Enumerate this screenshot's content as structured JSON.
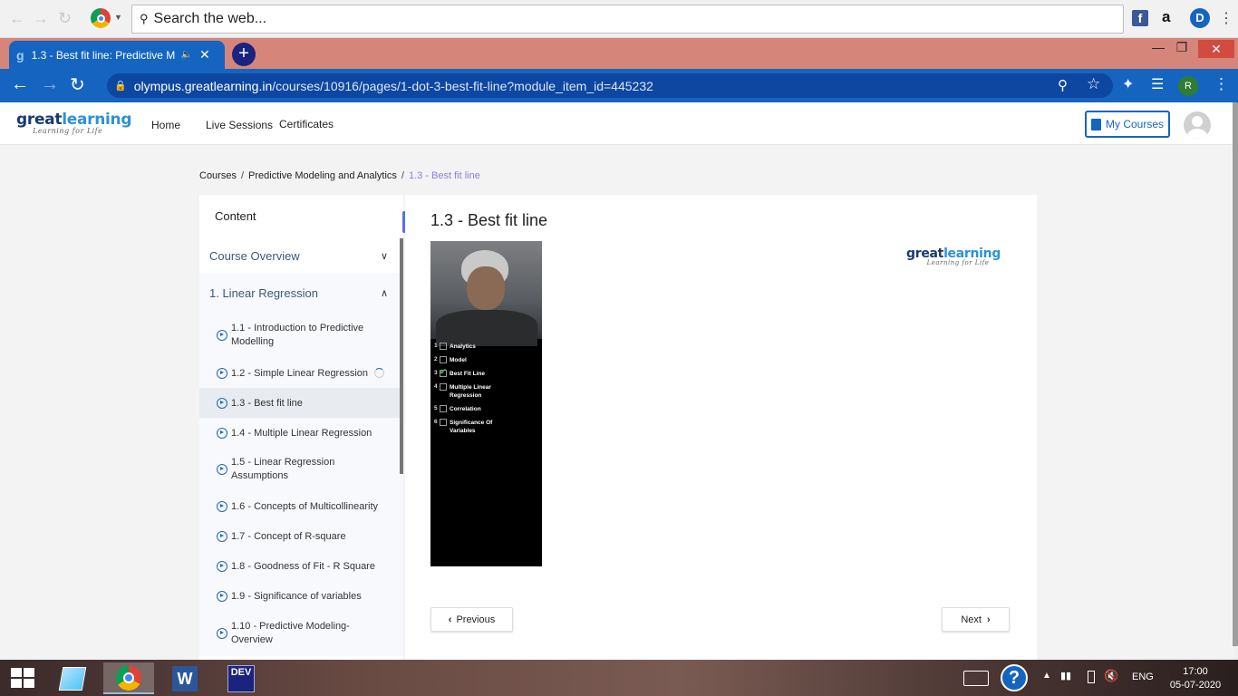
{
  "browser": {
    "top_search_placeholder": "Search the web...",
    "tab_title": "1.3 - Best fit line: Predictive M",
    "url_host": "olympus.greatlearning.in",
    "url_path": "/courses/10916/pages/1-dot-3-best-fit-line?module_item_id=445232",
    "profile_initial": "R",
    "ext_a": "a",
    "ext_d": "D"
  },
  "header": {
    "logo_main_a": "great",
    "logo_main_b": "learning",
    "logo_sub": "Learning for Life",
    "nav": [
      "Home",
      "Live Sessions",
      "Certificates"
    ],
    "my_courses": "My Courses"
  },
  "breadcrumb": {
    "items": [
      "Courses",
      "Predictive Modeling and Analytics"
    ],
    "current": "1.3 - Best fit line",
    "sep": "/"
  },
  "sidebar": {
    "title": "Content",
    "sections": [
      {
        "label": "Course Overview"
      },
      {
        "label": "1. Linear Regression"
      }
    ],
    "items": [
      {
        "label": "1.1 - Introduction to Predictive Modelling"
      },
      {
        "label": "1.2 - Simple Linear Regression"
      },
      {
        "label": "1.3 - Best fit line"
      },
      {
        "label": "1.4 - Multiple Linear Regression"
      },
      {
        "label": "1.5 - Linear Regression Assumptions"
      },
      {
        "label": "1.6 - Concepts of Multicollinearity"
      },
      {
        "label": "1.7 - Concept of R-square"
      },
      {
        "label": "1.8 - Goodness of Fit - R Square"
      },
      {
        "label": "1.9 - Significance of variables"
      },
      {
        "label": "1.10 - Predictive Modeling- Overview"
      }
    ]
  },
  "content": {
    "title": "1.3 - Best fit line",
    "video_topics": [
      {
        "n": "1",
        "label": "Analytics"
      },
      {
        "n": "2",
        "label": "Model"
      },
      {
        "n": "3",
        "label": "Best Fit Line"
      },
      {
        "n": "4",
        "label": "Multiple Linear Regression"
      },
      {
        "n": "5",
        "label": "Correlation"
      },
      {
        "n": "6",
        "label": "Significance Of Variables"
      }
    ],
    "prev": "Previous",
    "next": "Next"
  },
  "taskbar": {
    "app_dev": "DEV",
    "lang": "ENG",
    "time": "17:00",
    "date": "05-07-2020"
  },
  "colors": {
    "browser_blue": "#1565c0",
    "accent_purple": "#5a6ee8"
  }
}
